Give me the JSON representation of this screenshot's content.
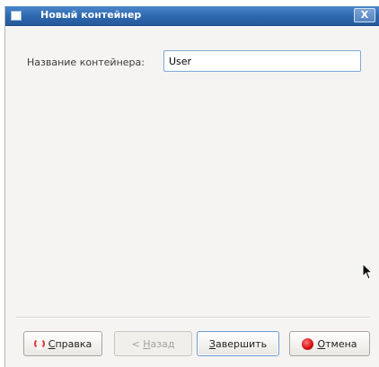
{
  "window": {
    "title": "Новый контейнер",
    "close_glyph": "X"
  },
  "form": {
    "name_label": "Название контейнера:",
    "name_value": "User"
  },
  "buttons": {
    "help": {
      "mnemonic": "С",
      "rest": "правка",
      "icon": "lifebuoy-icon"
    },
    "back": {
      "prefix": "< ",
      "mnemonic": "Н",
      "rest": "азад"
    },
    "finish": {
      "mnemonic": "З",
      "rest": "авершить"
    },
    "cancel": {
      "mnemonic": "О",
      "rest": "тмена",
      "icon": "stop-icon"
    }
  },
  "colors": {
    "titlebar": "#2d66ad",
    "input_border": "#7fa8d8",
    "cancel_icon": "#d40d0d"
  }
}
